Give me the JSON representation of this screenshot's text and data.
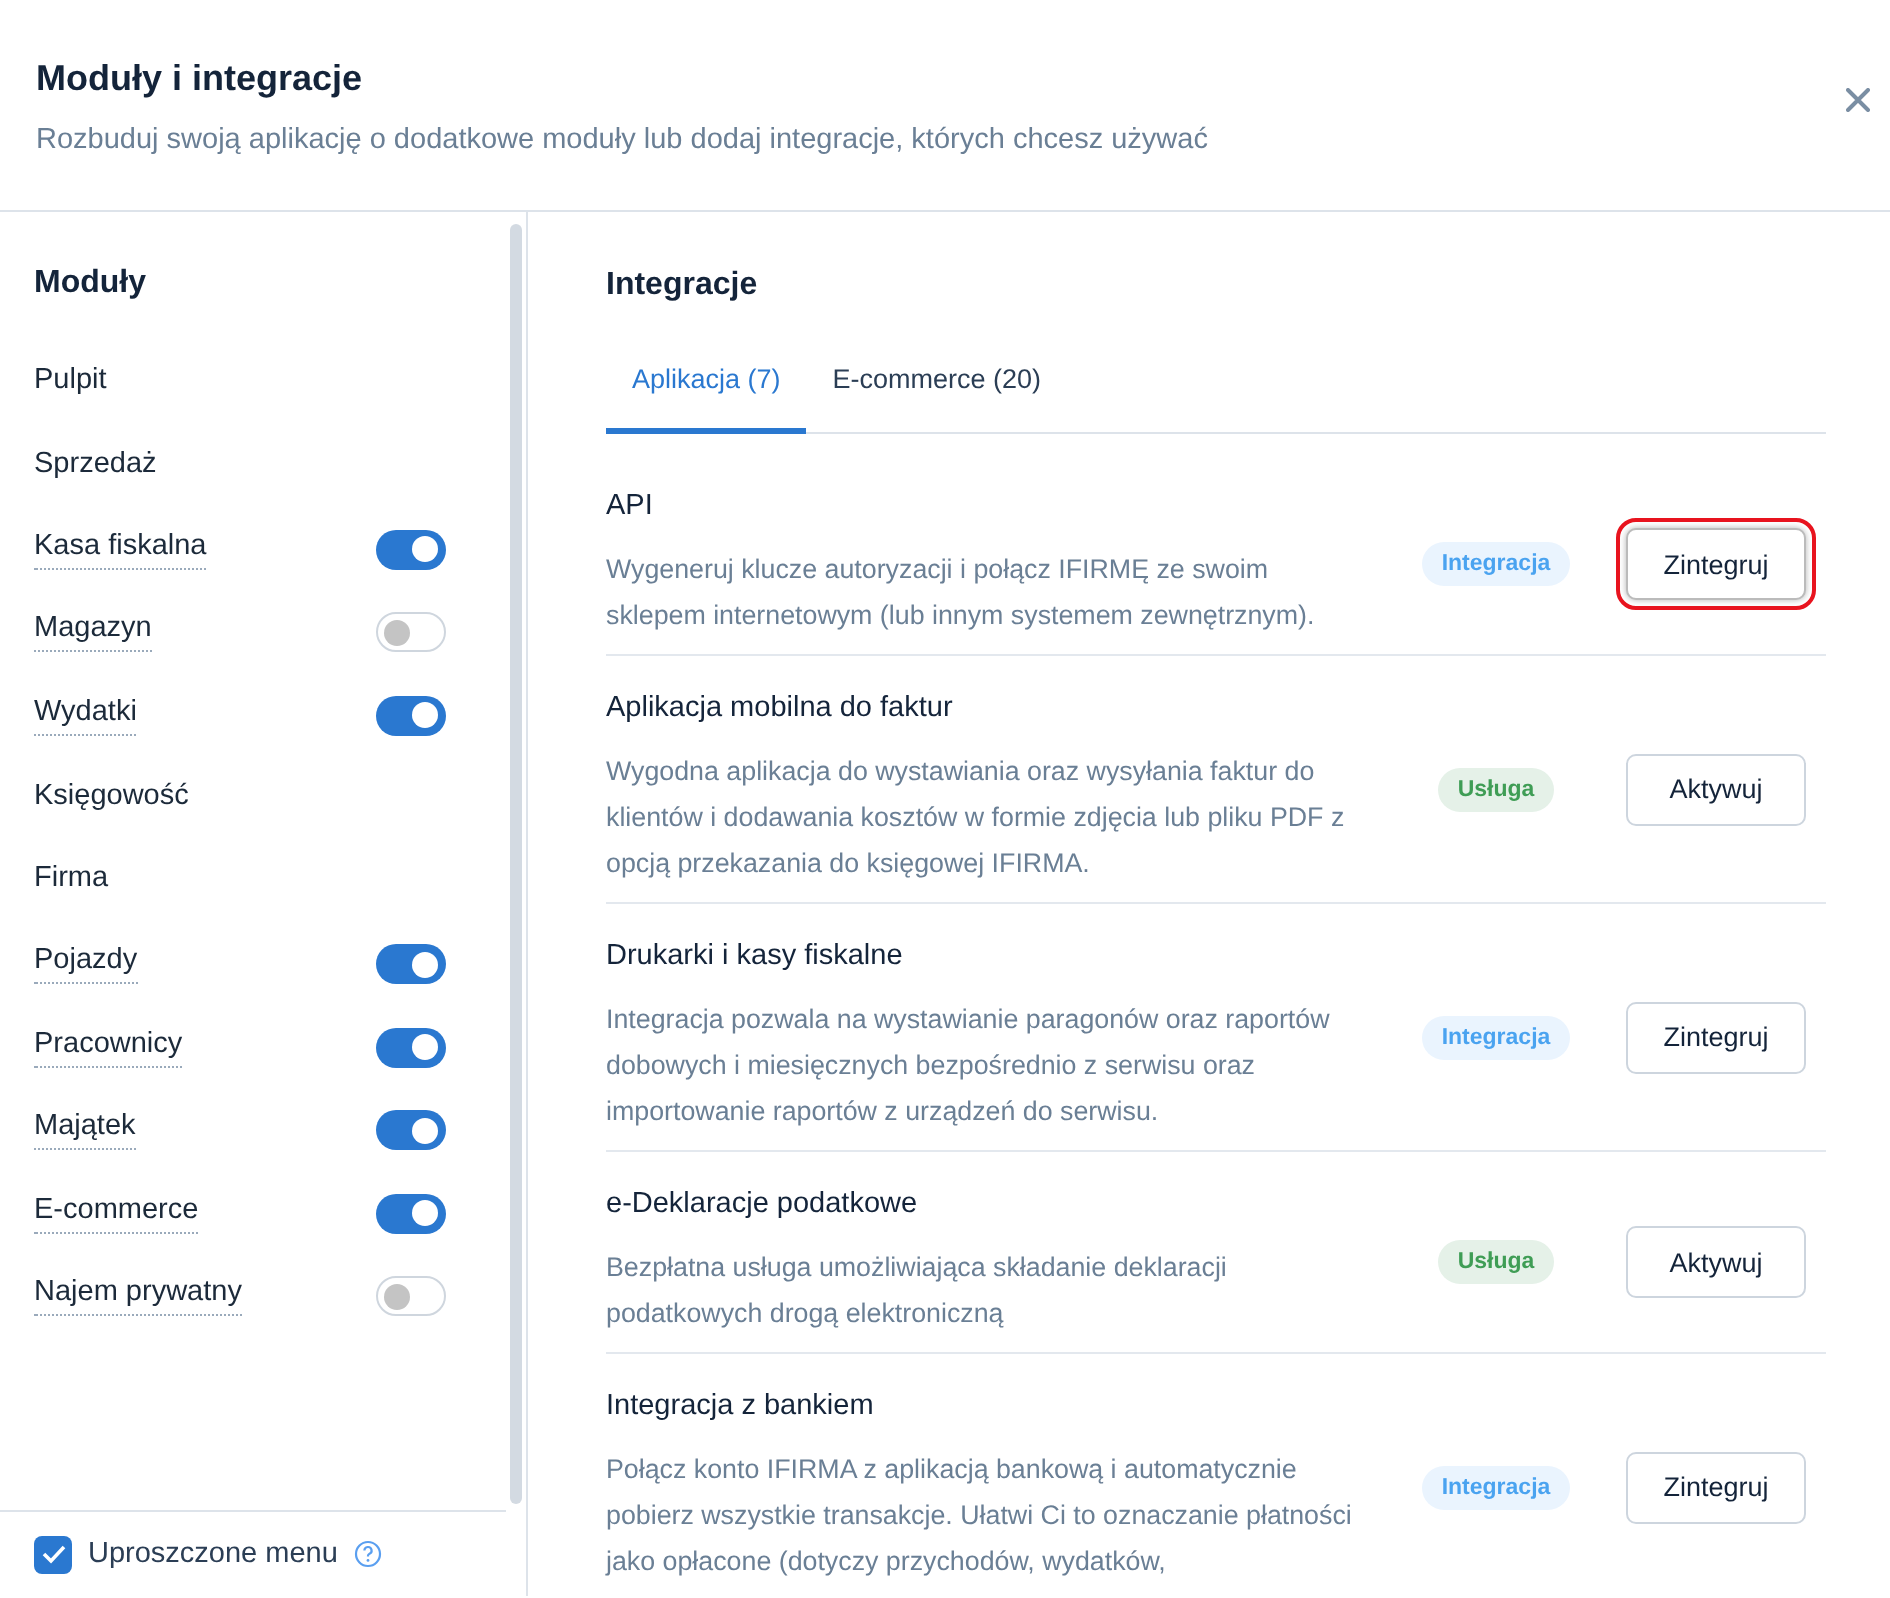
{
  "dialog": {
    "title": "Moduły i integracje",
    "subtitle": "Rozbuduj swoją aplikację o dodatkowe moduły lub dodaj integracje, których chcesz używać"
  },
  "sidebar": {
    "title": "Moduły",
    "items": [
      {
        "label": "Pulpit",
        "kind": "link"
      },
      {
        "label": "Sprzedaż",
        "kind": "link"
      },
      {
        "label": "Kasa fiskalna",
        "kind": "toggle",
        "on": true
      },
      {
        "label": "Magazyn",
        "kind": "toggle",
        "on": false
      },
      {
        "label": "Wydatki",
        "kind": "toggle",
        "on": true
      },
      {
        "label": "Księgowość",
        "kind": "link"
      },
      {
        "label": "Firma",
        "kind": "link"
      },
      {
        "label": "Pojazdy",
        "kind": "toggle",
        "on": true
      },
      {
        "label": "Pracownicy",
        "kind": "toggle",
        "on": true
      },
      {
        "label": "Majątek",
        "kind": "toggle",
        "on": true
      },
      {
        "label": "E-commerce",
        "kind": "toggle",
        "on": true
      },
      {
        "label": "Najem prywatny",
        "kind": "toggle",
        "on": false
      }
    ],
    "simplified_menu": {
      "label": "Uproszczone menu",
      "checked": true
    }
  },
  "main": {
    "title": "Integracje",
    "tabs": [
      {
        "label": "Aplikacja (7)",
        "selected": true
      },
      {
        "label": "E-commerce (20)",
        "selected": false
      }
    ],
    "integrations": [
      {
        "title": "API",
        "description": "Wygeneruj klucze autoryzacji i połącz IFIRMĘ ze swoim sklepem internetowym (lub innym systemem zewnętrznym).",
        "badge": {
          "label": "Integracja",
          "kind": "integration"
        },
        "button": "Zintegruj",
        "highlighted": true
      },
      {
        "title": "Aplikacja mobilna do faktur",
        "description": "Wygodna aplikacja do wystawiania oraz wysyłania faktur do klientów i dodawania kosztów w formie zdjęcia lub pliku PDF z opcją przekazania do księgowej IFIRMA.",
        "badge": {
          "label": "Usługa",
          "kind": "service"
        },
        "button": "Aktywuj",
        "highlighted": false
      },
      {
        "title": "Drukarki i kasy fiskalne",
        "description": "Integracja pozwala na wystawianie paragonów oraz raportów dobowych i miesięcznych bezpośrednio z serwisu oraz importowanie raportów z urządzeń do serwisu.",
        "badge": {
          "label": "Integracja",
          "kind": "integration"
        },
        "button": "Zintegruj",
        "highlighted": false
      },
      {
        "title": "e-Deklaracje podatkowe",
        "description": "Bezpłatna usługa umożliwiająca składanie deklaracji podatkowych drogą elektroniczną",
        "badge": {
          "label": "Usługa",
          "kind": "service"
        },
        "button": "Aktywuj",
        "highlighted": false
      },
      {
        "title": "Integracja z bankiem",
        "description": "Połącz konto IFIRMA z aplikacją bankową i automatycznie pobierz wszystkie transakcje. Ułatwi Ci to oznaczanie płatności jako opłacone (dotyczy przychodów, wydatków,",
        "badge": {
          "label": "Integracja",
          "kind": "integration"
        },
        "button": "Zintegruj",
        "highlighted": false
      }
    ]
  }
}
